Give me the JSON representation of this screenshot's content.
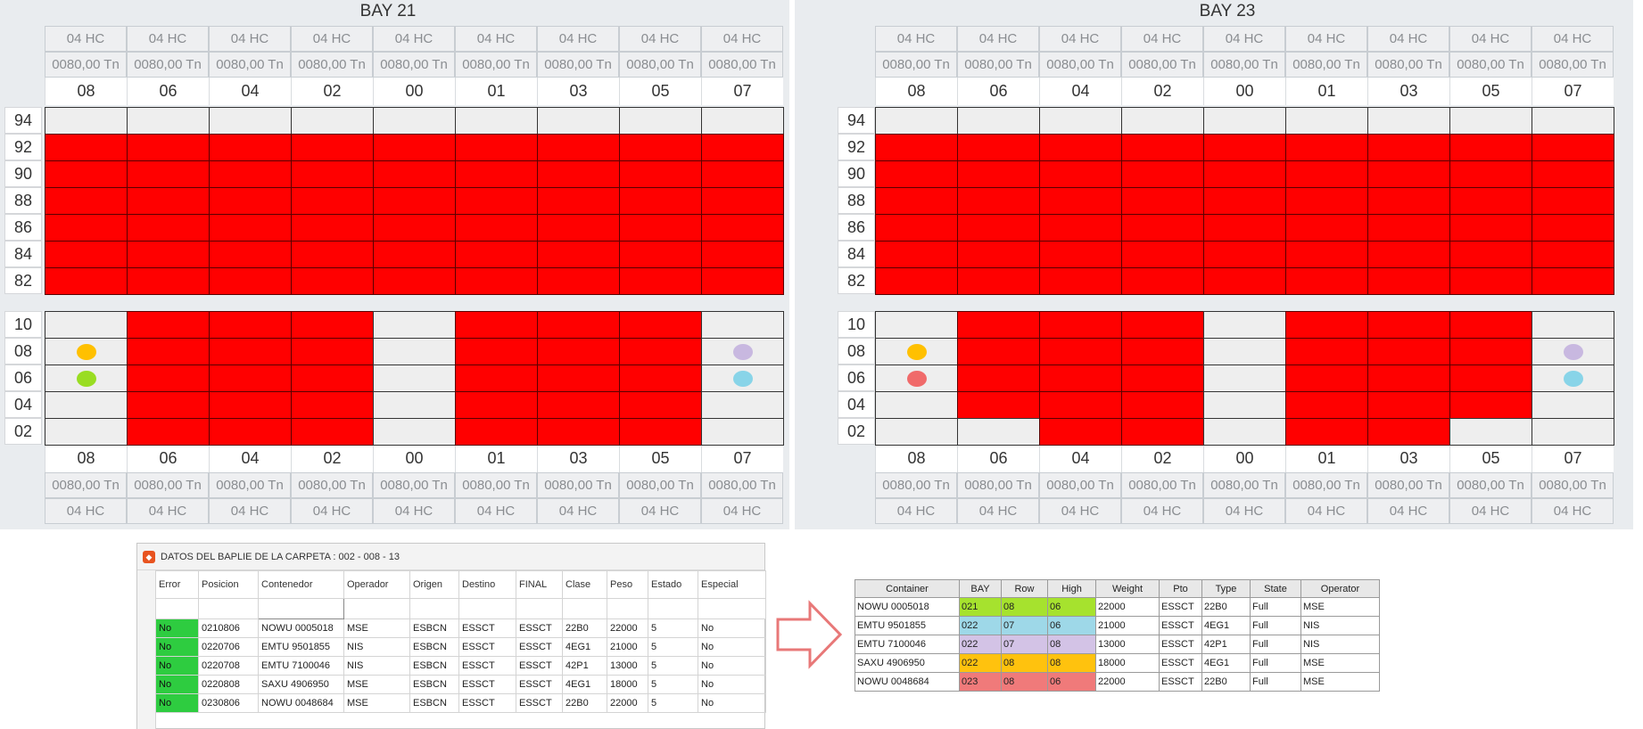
{
  "bays": [
    {
      "title": "BAY 21",
      "columns": [
        "08",
        "06",
        "04",
        "02",
        "00",
        "01",
        "03",
        "05",
        "07"
      ],
      "top_hc": [
        "04 HC",
        "04 HC",
        "04 HC",
        "04 HC",
        "04 HC",
        "04 HC",
        "04 HC",
        "04 HC",
        "04 HC"
      ],
      "top_tn": [
        "0080,00 Tn",
        "0080,00 Tn",
        "0080,00 Tn",
        "0080,00 Tn",
        "0080,00 Tn",
        "0080,00 Tn",
        "0080,00 Tn",
        "0080,00 Tn",
        "0080,00 Tn"
      ],
      "bottom_tn": [
        "0080,00 Tn",
        "0080,00 Tn",
        "0080,00 Tn",
        "0080,00 Tn",
        "0080,00 Tn",
        "0080,00 Tn",
        "0080,00 Tn",
        "0080,00 Tn",
        "0080,00 Tn"
      ],
      "bottom_hc": [
        "04 HC",
        "04 HC",
        "04 HC",
        "04 HC",
        "04 HC",
        "04 HC",
        "04 HC",
        "04 HC",
        "04 HC"
      ],
      "deck_tiers": [
        "94",
        "92",
        "90",
        "88",
        "86",
        "84",
        "82"
      ],
      "deck_grid": [
        [
          0,
          0,
          0,
          0,
          0,
          0,
          0,
          0,
          0
        ],
        [
          1,
          1,
          1,
          1,
          1,
          1,
          1,
          1,
          1
        ],
        [
          1,
          1,
          1,
          1,
          1,
          1,
          1,
          1,
          1
        ],
        [
          1,
          1,
          1,
          1,
          1,
          1,
          1,
          1,
          1
        ],
        [
          1,
          1,
          1,
          1,
          1,
          1,
          1,
          1,
          1
        ],
        [
          1,
          1,
          1,
          1,
          1,
          1,
          1,
          1,
          1
        ],
        [
          1,
          1,
          1,
          1,
          1,
          1,
          1,
          1,
          1
        ]
      ],
      "hold_tiers": [
        "10",
        "08",
        "06",
        "04",
        "02"
      ],
      "hold_grid": [
        [
          0,
          1,
          1,
          1,
          0,
          1,
          1,
          1,
          0
        ],
        [
          0,
          1,
          1,
          1,
          0,
          1,
          1,
          1,
          0
        ],
        [
          0,
          1,
          1,
          1,
          0,
          1,
          1,
          1,
          0
        ],
        [
          0,
          1,
          1,
          1,
          0,
          1,
          1,
          1,
          0
        ],
        [
          0,
          1,
          1,
          1,
          0,
          1,
          1,
          1,
          0
        ]
      ],
      "markers": [
        {
          "tier": 1,
          "col": 0,
          "color": "#ffc000"
        },
        {
          "tier": 2,
          "col": 0,
          "color": "#99dd22"
        },
        {
          "tier": 1,
          "col": 8,
          "color": "#c8b8e0"
        },
        {
          "tier": 2,
          "col": 8,
          "color": "#88d4e8"
        }
      ]
    },
    {
      "title": "BAY 23",
      "columns": [
        "08",
        "06",
        "04",
        "02",
        "00",
        "01",
        "03",
        "05",
        "07"
      ],
      "top_hc": [
        "04 HC",
        "04 HC",
        "04 HC",
        "04 HC",
        "04 HC",
        "04 HC",
        "04 HC",
        "04 HC",
        "04 HC"
      ],
      "top_tn": [
        "0080,00 Tn",
        "0080,00 Tn",
        "0080,00 Tn",
        "0080,00 Tn",
        "0080,00 Tn",
        "0080,00 Tn",
        "0080,00 Tn",
        "0080,00 Tn",
        "0080,00 Tn"
      ],
      "bottom_tn": [
        "0080,00 Tn",
        "0080,00 Tn",
        "0080,00 Tn",
        "0080,00 Tn",
        "0080,00 Tn",
        "0080,00 Tn",
        "0080,00 Tn",
        "0080,00 Tn",
        "0080,00 Tn"
      ],
      "bottom_hc": [
        "04 HC",
        "04 HC",
        "04 HC",
        "04 HC",
        "04 HC",
        "04 HC",
        "04 HC",
        "04 HC",
        "04 HC"
      ],
      "deck_tiers": [
        "94",
        "92",
        "90",
        "88",
        "86",
        "84",
        "82"
      ],
      "deck_grid": [
        [
          0,
          0,
          0,
          0,
          0,
          0,
          0,
          0,
          0
        ],
        [
          1,
          1,
          1,
          1,
          1,
          1,
          1,
          1,
          1
        ],
        [
          1,
          1,
          1,
          1,
          1,
          1,
          1,
          1,
          1
        ],
        [
          1,
          1,
          1,
          1,
          1,
          1,
          1,
          1,
          1
        ],
        [
          1,
          1,
          1,
          1,
          1,
          1,
          1,
          1,
          1
        ],
        [
          1,
          1,
          1,
          1,
          1,
          1,
          1,
          1,
          1
        ],
        [
          1,
          1,
          1,
          1,
          1,
          1,
          1,
          1,
          1
        ]
      ],
      "hold_tiers": [
        "10",
        "08",
        "06",
        "04",
        "02"
      ],
      "hold_grid": [
        [
          0,
          1,
          1,
          1,
          0,
          1,
          1,
          1,
          0
        ],
        [
          0,
          1,
          1,
          1,
          0,
          1,
          1,
          1,
          0
        ],
        [
          0,
          1,
          1,
          1,
          0,
          1,
          1,
          1,
          0
        ],
        [
          0,
          1,
          1,
          1,
          0,
          1,
          1,
          1,
          0
        ],
        [
          0,
          0,
          1,
          1,
          0,
          1,
          1,
          0,
          0
        ]
      ],
      "markers": [
        {
          "tier": 1,
          "col": 0,
          "color": "#ffc000"
        },
        {
          "tier": 2,
          "col": 0,
          "color": "#f06a6a"
        },
        {
          "tier": 1,
          "col": 8,
          "color": "#c8b8e0"
        },
        {
          "tier": 2,
          "col": 8,
          "color": "#88d4e8"
        }
      ]
    }
  ],
  "baplie": {
    "title": "DATOS DEL BAPLIE DE LA CARPETA : 002 - 008 - 13",
    "columns": [
      "Error",
      "Posicion",
      "Contenedor",
      "Operador",
      "Origen",
      "Destino",
      "FINAL",
      "Clase",
      "Peso",
      "Estado",
      "Especial"
    ],
    "filter_icon": "φ",
    "rows": [
      [
        "No",
        "0210806",
        "NOWU 0005018",
        "MSE",
        "ESBCN",
        "ESSCT",
        "ESSCT",
        "22B0",
        "22000",
        "5",
        "No"
      ],
      [
        "No",
        "0220706",
        "EMTU 9501855",
        "NIS",
        "ESBCN",
        "ESSCT",
        "ESSCT",
        "4EG1",
        "21000",
        "5",
        "No"
      ],
      [
        "No",
        "0220708",
        "EMTU 7100046",
        "NIS",
        "ESBCN",
        "ESSCT",
        "ESSCT",
        "42P1",
        "13000",
        "5",
        "No"
      ],
      [
        "No",
        "0220808",
        "SAXU 4906950",
        "MSE",
        "ESBCN",
        "ESSCT",
        "ESSCT",
        "4EG1",
        "18000",
        "5",
        "No"
      ],
      [
        "No",
        "0230806",
        "NOWU 0048684",
        "MSE",
        "ESBCN",
        "ESSCT",
        "ESSCT",
        "22B0",
        "22000",
        "5",
        "No"
      ]
    ],
    "error_color": "#2ecc40"
  },
  "summary": {
    "columns": [
      "Container",
      "BAY",
      "Row",
      "High",
      "Weight",
      "Pto",
      "Type",
      "State",
      "Operator"
    ],
    "rows": [
      {
        "cells": [
          "NOWU 0005018",
          "021",
          "08",
          "06",
          "22000",
          "ESSCT",
          "22B0",
          "Full",
          "MSE"
        ],
        "color": "#a6e22e"
      },
      {
        "cells": [
          "EMTU 9501855",
          "022",
          "07",
          "06",
          "21000",
          "ESSCT",
          "4EG1",
          "Full",
          "NIS"
        ],
        "color": "#9ed8e8"
      },
      {
        "cells": [
          "EMTU 7100046",
          "022",
          "07",
          "08",
          "13000",
          "ESSCT",
          "42P1",
          "Full",
          "NIS"
        ],
        "color": "#d3c3e6"
      },
      {
        "cells": [
          "SAXU 4906950",
          "022",
          "08",
          "08",
          "18000",
          "ESSCT",
          "4EG1",
          "Full",
          "MSE"
        ],
        "color": "#ffc20e"
      },
      {
        "cells": [
          "NOWU 0048684",
          "023",
          "08",
          "06",
          "22000",
          "ESSCT",
          "22B0",
          "Full",
          "MSE"
        ],
        "color": "#f07a7a"
      }
    ]
  },
  "icons": {
    "arrow": "right-arrow-icon",
    "window": "app-icon",
    "filter": "filter-icon"
  },
  "colors": {
    "full_slot": "#ff0000",
    "empty_slot": "#eeeeee",
    "panel_bg": "#e9ecef"
  }
}
